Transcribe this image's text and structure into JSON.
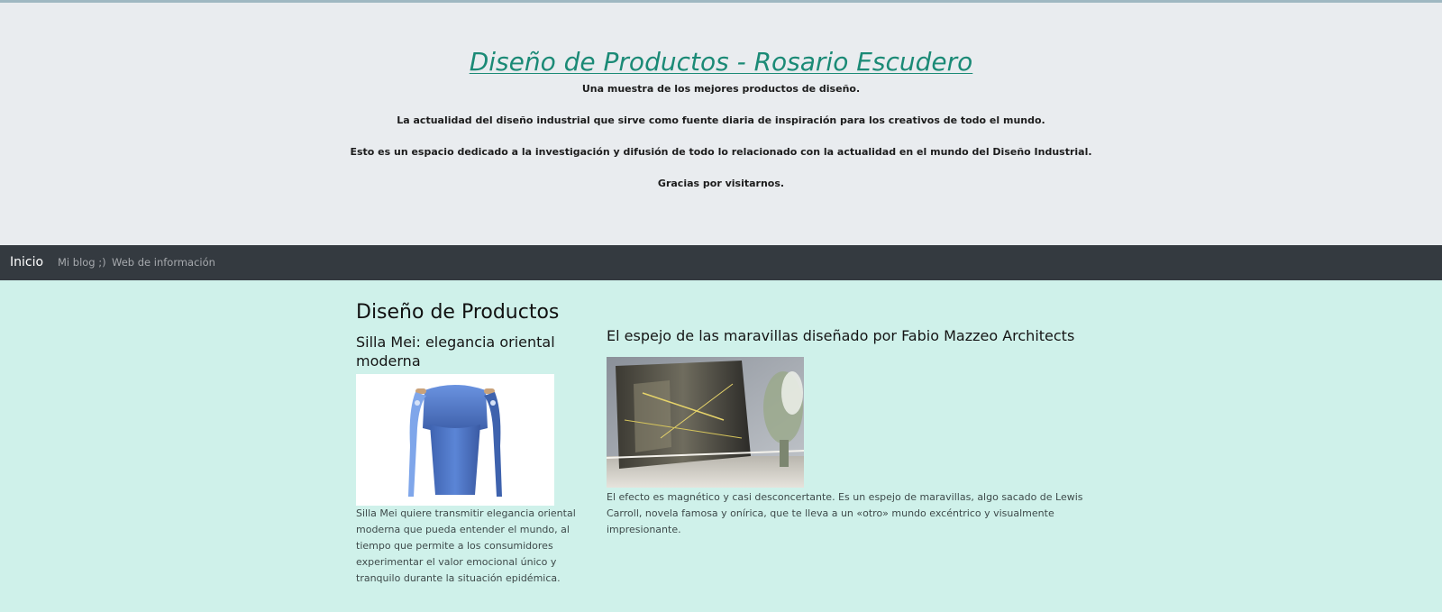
{
  "header": {
    "title": "Diseño de Productos - Rosario Escudero",
    "taglines": [
      "Una muestra de los mejores productos de diseño.",
      "La actualidad del diseño industrial que sirve como fuente diaria de inspiración para los creativos de todo el mundo.",
      "Esto es un espacio dedicado a la investigación y difusión de todo lo relacionado con la actualidad en el mundo del Diseño Industrial.",
      "Gracias por visitarnos."
    ]
  },
  "nav": {
    "brand": "Inicio",
    "links": [
      "Mi blog ;)",
      "Web de información"
    ]
  },
  "main": {
    "heading": "Diseño de Productos",
    "posts": [
      {
        "title": "Silla Mei: elegancia oriental moderna",
        "excerpt": "Silla Mei quiere transmitir elegancia oriental moderna que pueda entender el mundo, al tiempo que permite a los consumidores experimentar el valor emocional único y tranquilo durante la situación epidémica."
      },
      {
        "title": "El espejo de las maravillas diseñado por Fabio Mazzeo Architects",
        "excerpt": "El efecto es magnético y casi desconcertante. Es un espejo de maravillas, algo sacado de Lewis Carroll, novela famosa y onírica, que te lleva a un «otro» mundo excéntrico y visualmente impresionante."
      }
    ]
  },
  "colors": {
    "title": "#1b8a76",
    "header_bg": "#e9ecef",
    "nav_bg": "#343a40",
    "content_bg": "#cff1ea"
  }
}
